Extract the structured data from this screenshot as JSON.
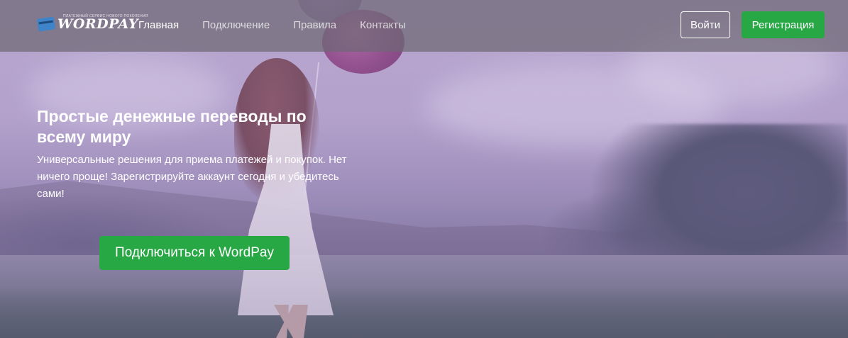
{
  "brand": {
    "name": "WORDPAY",
    "tagline": "ПЛАТЕЖНЫЙ СЕРВИС НОВОГО ПОКОЛЕНИЯ"
  },
  "nav": {
    "items": [
      {
        "label": "Главная",
        "active": true
      },
      {
        "label": "Подключение",
        "active": false
      },
      {
        "label": "Правила",
        "active": false
      },
      {
        "label": "Контакты",
        "active": false
      }
    ],
    "login_label": "Войти",
    "register_label": "Регистрация"
  },
  "hero": {
    "title": "Простые денежные переводы по всему миру",
    "lead": "Универсальные решения для приема платежей и покупок. Нет ничего проще! Зарегистрируйте аккаунт сегодня и убедитесь сами!",
    "cta_label": "Подключиться к WordPay"
  },
  "colors": {
    "accent_green": "#28a745",
    "navbar_bg": "#6e6874",
    "overlay_tint": "#b3a1cc"
  },
  "icons": {
    "brand_logo": "credit-card-icon"
  }
}
